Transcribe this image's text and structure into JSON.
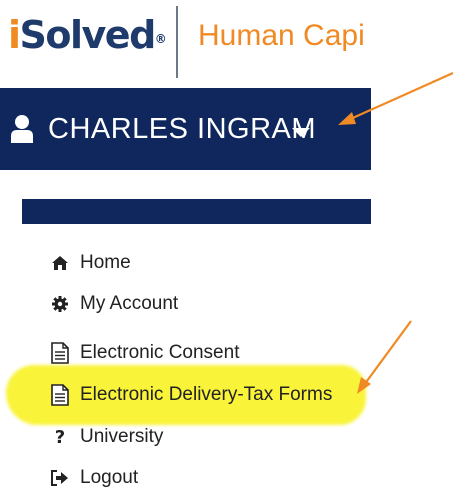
{
  "logo": {
    "brand_i": "i",
    "brand_rest": "Solved",
    "registered": "®",
    "tagline": "Human Capi"
  },
  "user": {
    "name": "CHARLES INGRAM"
  },
  "menu": [
    {
      "label": "Home",
      "icon": "home-icon"
    },
    {
      "label": "My Account",
      "icon": "gear-icon"
    },
    {
      "label": "Electronic Consent",
      "icon": "document-icon"
    },
    {
      "label": "Electronic Delivery-Tax Forms",
      "icon": "document-icon"
    },
    {
      "label": "University",
      "icon": "question-icon"
    },
    {
      "label": "Logout",
      "icon": "logout-icon"
    }
  ],
  "colors": {
    "brand_navy": "#10275e",
    "accent_orange": "#f08a24",
    "highlight": "#f9f33a"
  }
}
